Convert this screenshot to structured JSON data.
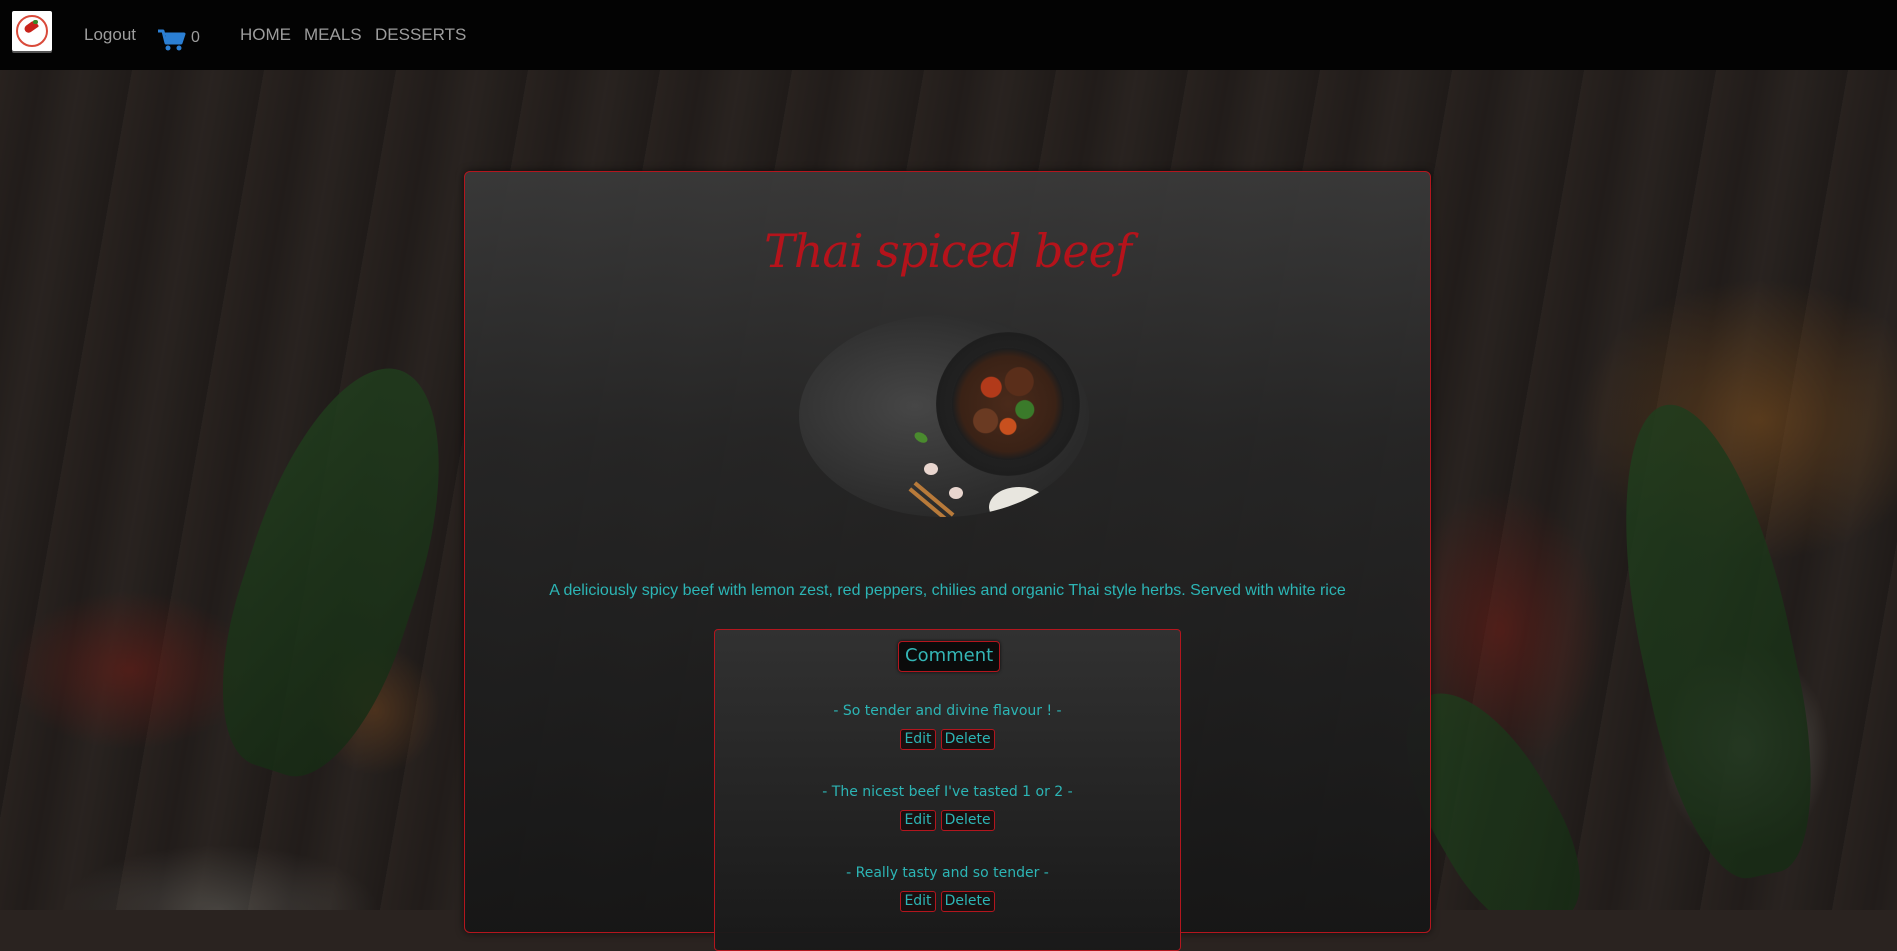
{
  "nav": {
    "logo_name": "chili-logo",
    "logout_label": "Logout",
    "cart_count": "0",
    "links": [
      "HOME",
      "MEALS",
      "DESSERTS"
    ]
  },
  "meal": {
    "title": "Thai spiced beef",
    "description": "A deliciously spicy beef with lemon zest, red peppers, chilies and organic Thai style herbs. Served with white rice"
  },
  "comments": {
    "button_label": "Comment",
    "items": [
      {
        "text": "- So tender and divine flavour ! -",
        "edit": "Edit",
        "delete": "Delete"
      },
      {
        "text": "- The nicest beef I've tasted 1 or 2 -",
        "edit": "Edit",
        "delete": "Delete"
      },
      {
        "text": "- Really tasty and so tender -",
        "edit": "Edit",
        "delete": "Delete"
      }
    ]
  },
  "colors": {
    "accent_red": "#b3161e",
    "teal_text": "#2cb5b5",
    "navbar_bg": "#030303",
    "nav_text": "#9d9d9d",
    "cart_blue": "#2b7fd4"
  }
}
